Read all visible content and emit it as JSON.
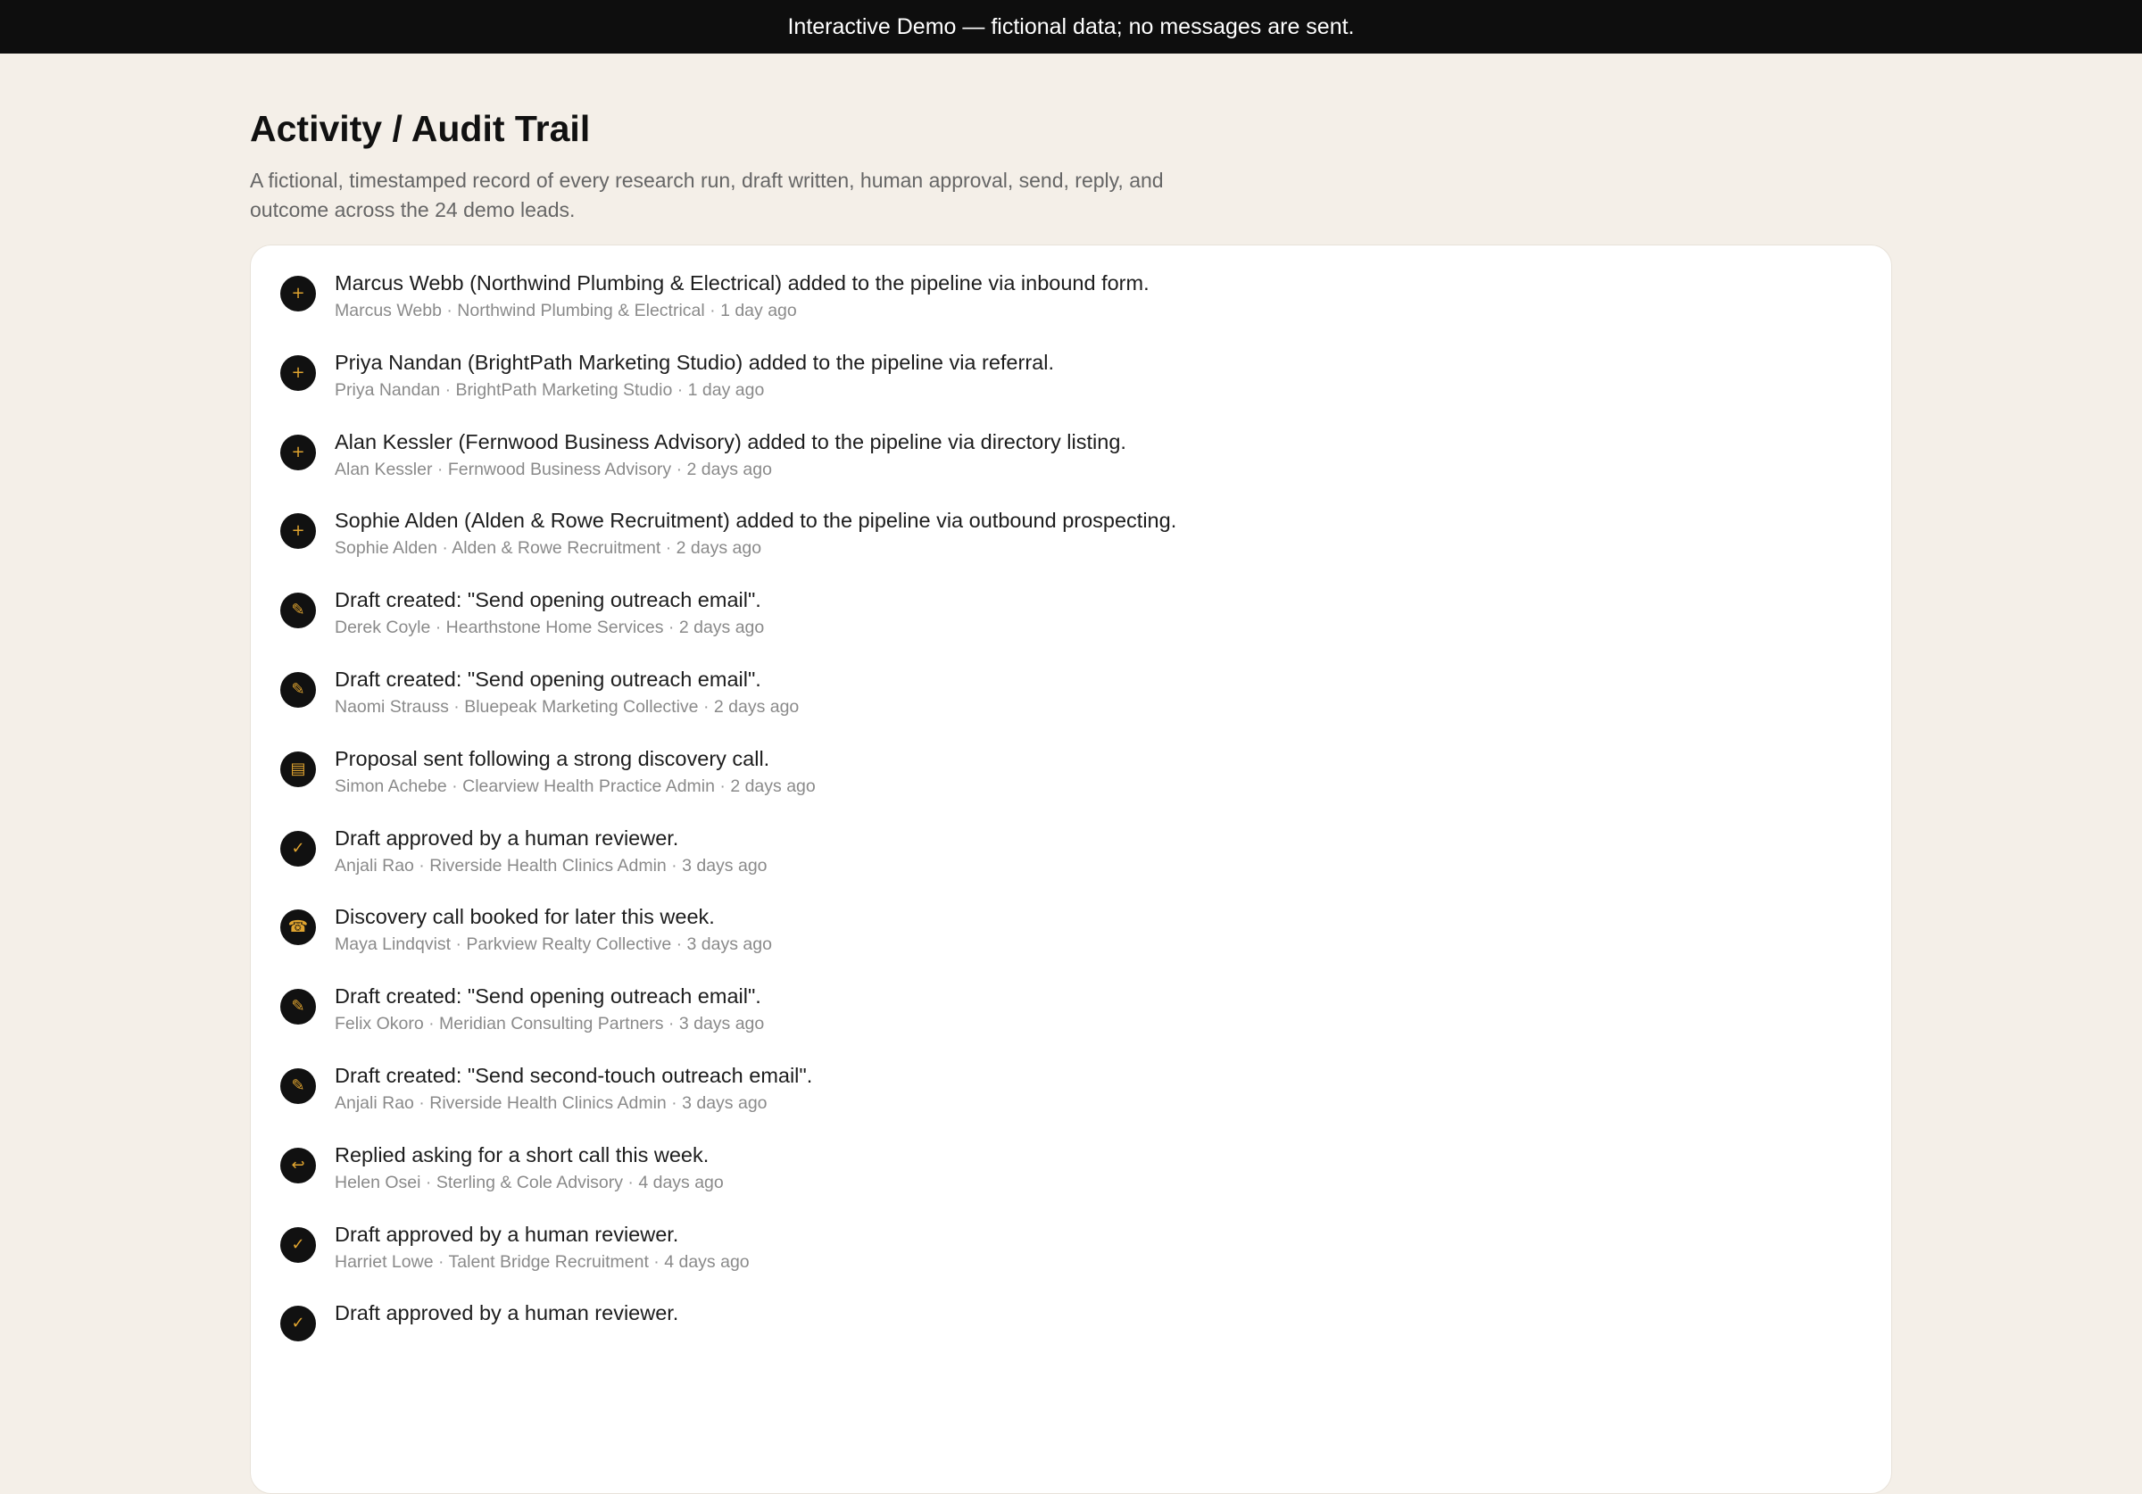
{
  "banner": {
    "text": "Interactive Demo — fictional data; no messages are sent."
  },
  "page": {
    "title": "Activity / Audit Trail",
    "description": "A fictional, timestamped record of every research run, draft written, human approval, send, reply, and outcome across the 24 demo leads."
  },
  "icons": {
    "added": "plus-icon",
    "draft": "pencil-icon",
    "proposal": "document-icon",
    "approved": "check-icon",
    "call": "phone-icon",
    "reply": "reply-icon"
  },
  "colors": {
    "banner_bg": "#0e0e0e",
    "page_bg": "#f4efe8",
    "icon_bg": "#111111",
    "icon_accent": "#e0a42f"
  },
  "activities": [
    {
      "type": "added",
      "glyph": "+",
      "text": "Marcus Webb (Northwind Plumbing & Electrical) added to the pipeline via inbound form.",
      "person": "Marcus Webb",
      "company": "Northwind Plumbing & Electrical",
      "time": "1 day ago"
    },
    {
      "type": "added",
      "glyph": "+",
      "text": "Priya Nandan (BrightPath Marketing Studio) added to the pipeline via referral.",
      "person": "Priya Nandan",
      "company": "BrightPath Marketing Studio",
      "time": "1 day ago"
    },
    {
      "type": "added",
      "glyph": "+",
      "text": "Alan Kessler (Fernwood Business Advisory) added to the pipeline via directory listing.",
      "person": "Alan Kessler",
      "company": "Fernwood Business Advisory",
      "time": "2 days ago"
    },
    {
      "type": "added",
      "glyph": "+",
      "text": "Sophie Alden (Alden & Rowe Recruitment) added to the pipeline via outbound prospecting.",
      "person": "Sophie Alden",
      "company": "Alden & Rowe Recruitment",
      "time": "2 days ago"
    },
    {
      "type": "draft",
      "glyph": "✎",
      "text": "Draft created: \"Send opening outreach email\".",
      "person": "Derek Coyle",
      "company": "Hearthstone Home Services",
      "time": "2 days ago"
    },
    {
      "type": "draft",
      "glyph": "✎",
      "text": "Draft created: \"Send opening outreach email\".",
      "person": "Naomi Strauss",
      "company": "Bluepeak Marketing Collective",
      "time": "2 days ago"
    },
    {
      "type": "proposal",
      "glyph": "▤",
      "text": "Proposal sent following a strong discovery call.",
      "person": "Simon Achebe",
      "company": "Clearview Health Practice Admin",
      "time": "2 days ago"
    },
    {
      "type": "approved",
      "glyph": "✓",
      "text": "Draft approved by a human reviewer.",
      "person": "Anjali Rao",
      "company": "Riverside Health Clinics Admin",
      "time": "3 days ago"
    },
    {
      "type": "call",
      "glyph": "☎",
      "text": "Discovery call booked for later this week.",
      "person": "Maya Lindqvist",
      "company": "Parkview Realty Collective",
      "time": "3 days ago"
    },
    {
      "type": "draft",
      "glyph": "✎",
      "text": "Draft created: \"Send opening outreach email\".",
      "person": "Felix Okoro",
      "company": "Meridian Consulting Partners",
      "time": "3 days ago"
    },
    {
      "type": "draft",
      "glyph": "✎",
      "text": "Draft created: \"Send second-touch outreach email\".",
      "person": "Anjali Rao",
      "company": "Riverside Health Clinics Admin",
      "time": "3 days ago"
    },
    {
      "type": "reply",
      "glyph": "↩",
      "text": "Replied asking for a short call this week.",
      "person": "Helen Osei",
      "company": "Sterling & Cole Advisory",
      "time": "4 days ago"
    },
    {
      "type": "approved",
      "glyph": "✓",
      "text": "Draft approved by a human reviewer.",
      "person": "Harriet Lowe",
      "company": "Talent Bridge Recruitment",
      "time": "4 days ago"
    },
    {
      "type": "approved",
      "glyph": "✓",
      "text": "Draft approved by a human reviewer.",
      "person": "",
      "company": "",
      "time": ""
    }
  ]
}
